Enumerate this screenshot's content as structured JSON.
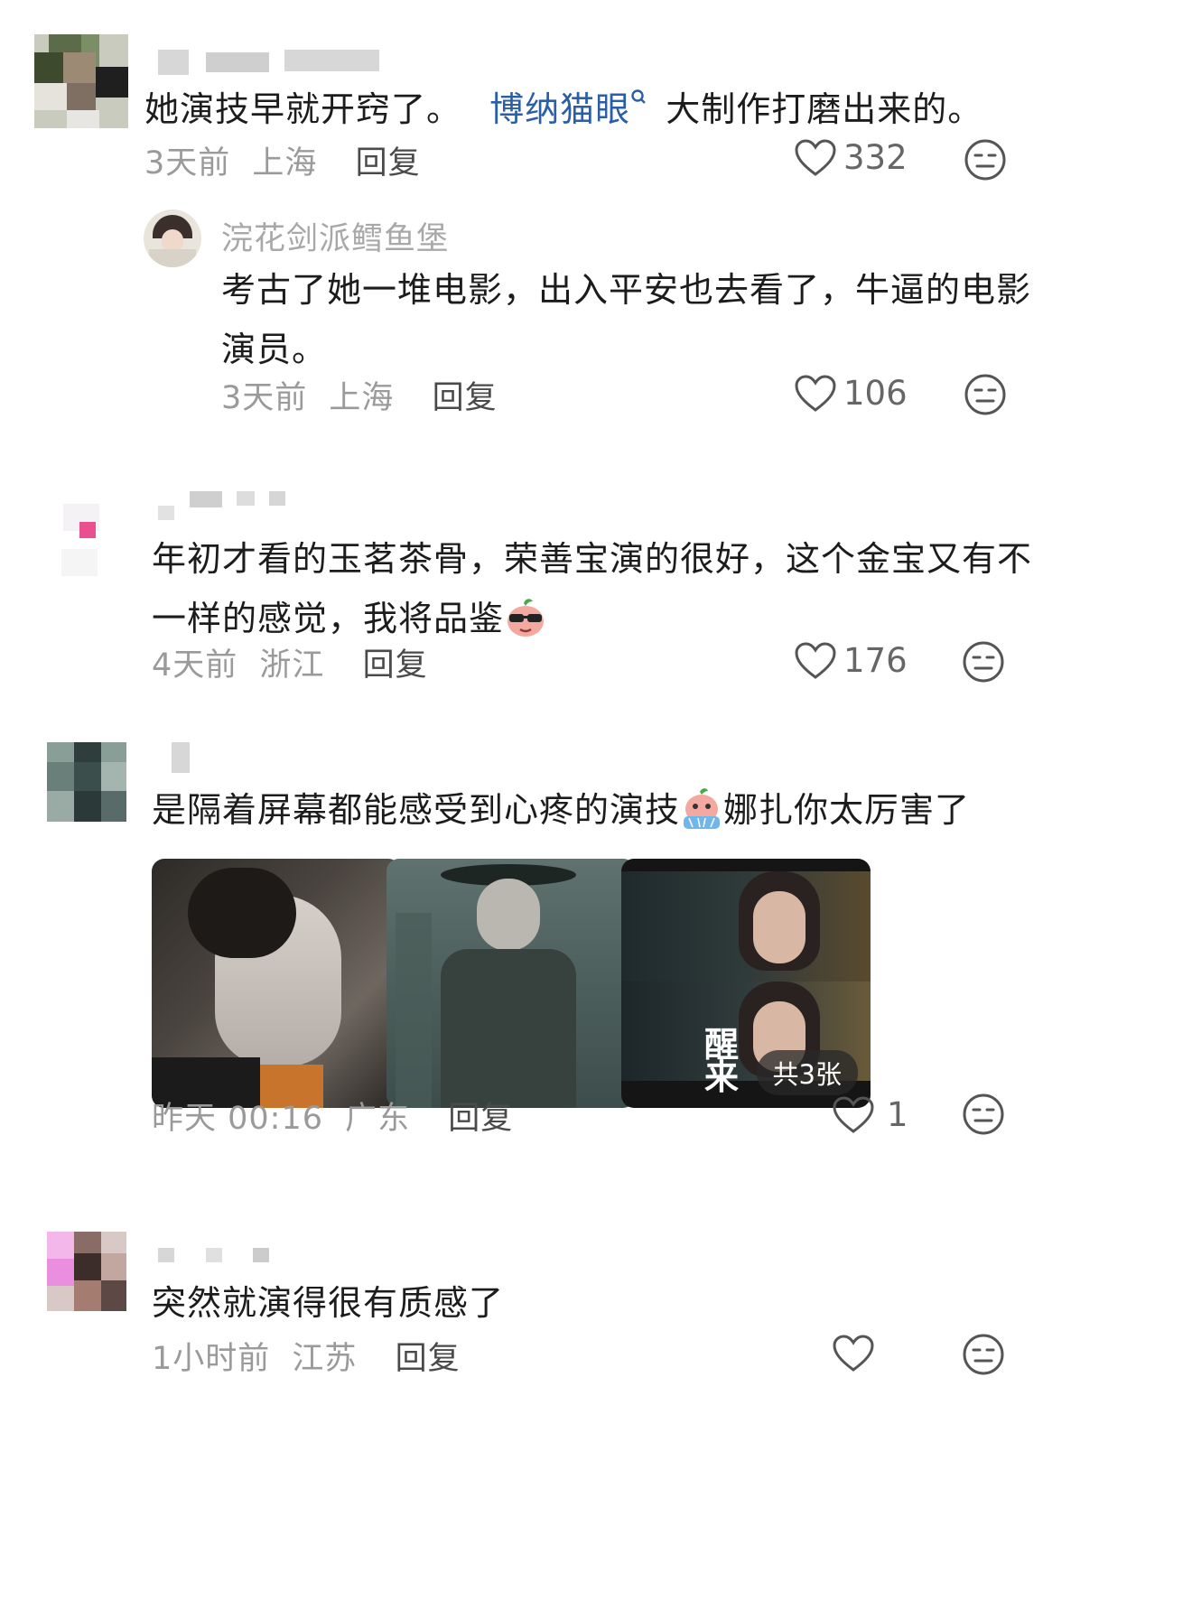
{
  "comments": [
    {
      "text_before": "她演技早就开窍了。",
      "link": "博纳猫眼",
      "text_after": "大制作打磨出来的。",
      "time": "3天前",
      "location": "上海",
      "reply": "回复",
      "likes": "332"
    },
    {
      "username": "浣花剑派鳕鱼堡",
      "text_line1": "考古了她一堆电影，出入平安也去看了，牛逼的电影",
      "text_line2": "演员。",
      "time": "3天前",
      "location": "上海",
      "reply": "回复",
      "likes": "106"
    },
    {
      "text_line1": "年初才看的玉茗茶骨，荣善宝演的很好，这个金宝又有不",
      "text_line2": "一样的感觉，我将品鉴",
      "time": "4天前",
      "location": "浙江",
      "reply": "回复",
      "likes": "176"
    },
    {
      "text_before": "是隔着屏幕都能感受到心疼的演技",
      "text_after": "娜扎你太厉害了",
      "image_count": "共3张",
      "time": "昨天 00:16",
      "location": "广东",
      "reply": "回复",
      "likes": "1"
    },
    {
      "text": "突然就演得很有质感了",
      "time": "1小时前",
      "location": "江苏",
      "reply": "回复"
    }
  ],
  "poster_title": "醒来",
  "colors": {
    "link": "#2b5ea8",
    "meta": "#9a9a9a",
    "text": "#1c1c1c"
  }
}
